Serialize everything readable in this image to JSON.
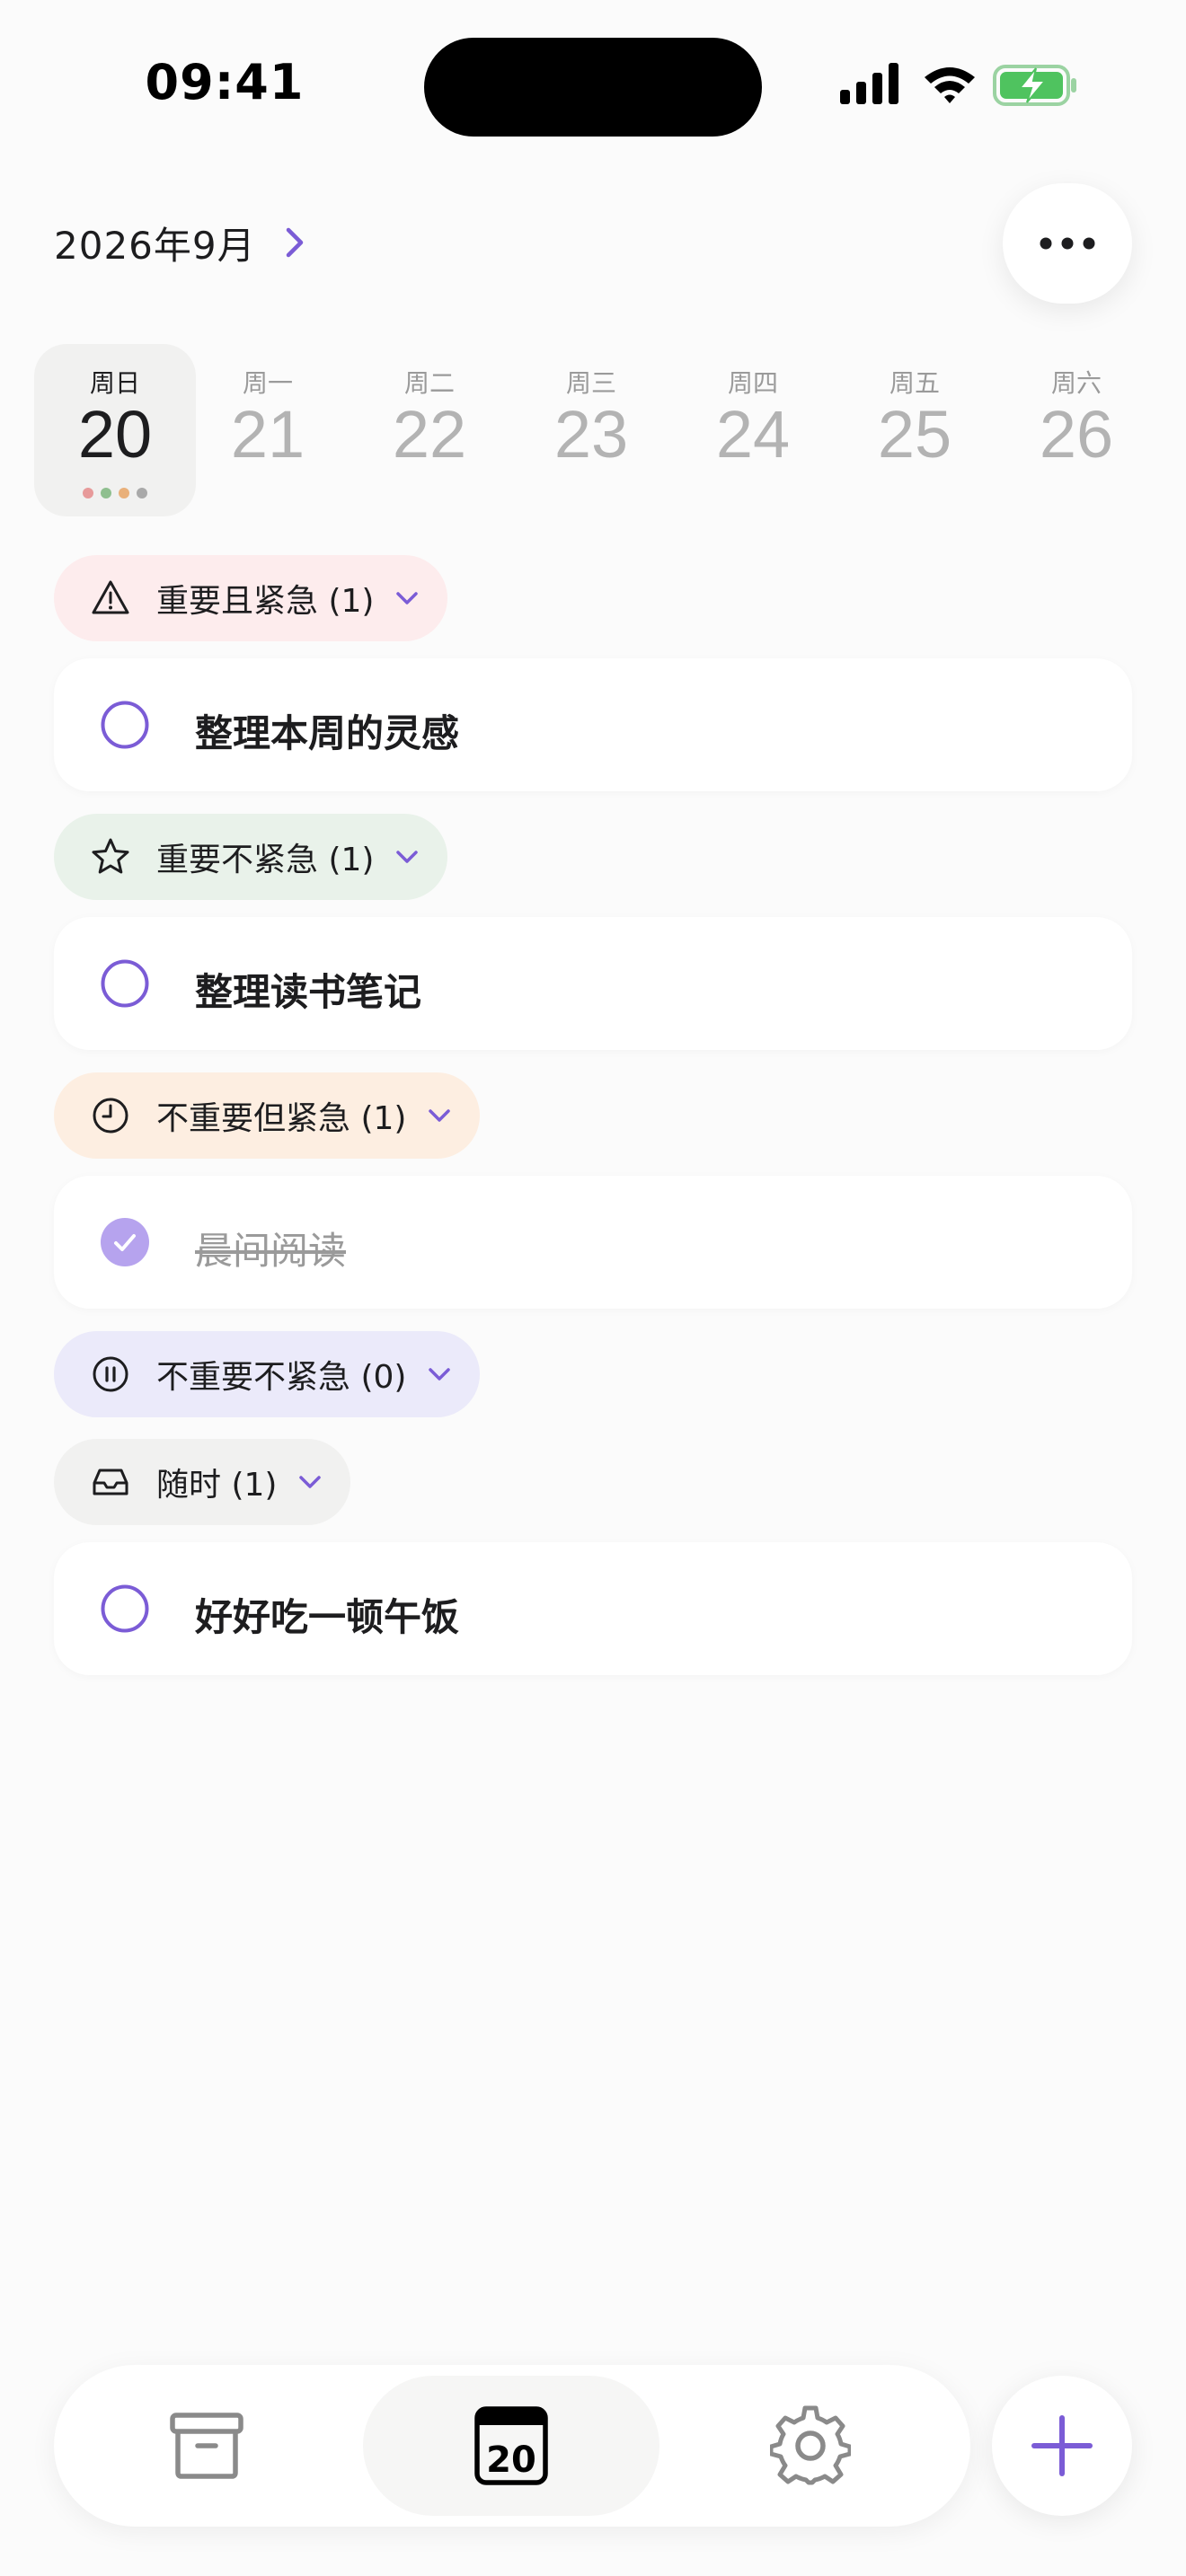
{
  "status_bar": {
    "time": "09:41"
  },
  "header": {
    "month": "2026年9月"
  },
  "week": [
    {
      "weekday": "周日",
      "date": "20",
      "selected": true
    },
    {
      "weekday": "周一",
      "date": "21",
      "selected": false
    },
    {
      "weekday": "周二",
      "date": "22",
      "selected": false
    },
    {
      "weekday": "周三",
      "date": "23",
      "selected": false
    },
    {
      "weekday": "周四",
      "date": "24",
      "selected": false
    },
    {
      "weekday": "周五",
      "date": "25",
      "selected": false
    },
    {
      "weekday": "周六",
      "date": "26",
      "selected": false
    }
  ],
  "day_dots": [
    "#e79a9a",
    "#8fbf8f",
    "#e9b07a",
    "#a9a9a9"
  ],
  "sections": [
    {
      "label": "重要且紧急 (1)",
      "icon": "warning-triangle-icon",
      "bg": "#fdeced",
      "tasks": [
        {
          "title": "整理本周的灵感",
          "done": false
        }
      ]
    },
    {
      "label": "重要不紧急 (1)",
      "icon": "star-icon",
      "bg": "#e9f2ea",
      "tasks": [
        {
          "title": "整理读书笔记",
          "done": false
        }
      ]
    },
    {
      "label": "不重要但紧急 (1)",
      "icon": "clock-icon",
      "bg": "#fdeee1",
      "tasks": [
        {
          "title": "晨间阅读",
          "done": true
        }
      ]
    },
    {
      "label": "不重要不紧急 (0)",
      "icon": "pause-circle-icon",
      "bg": "#ebeafa",
      "tasks": []
    },
    {
      "label": "随时 (1)",
      "icon": "inbox-tray-icon",
      "bg": "#f1f1f0",
      "tasks": [
        {
          "title": "好好吃一顿午饭",
          "done": false
        }
      ]
    }
  ],
  "tab_bar": {
    "tabs": [
      {
        "name": "archive",
        "icon": "archive-box-icon"
      },
      {
        "name": "calendar",
        "icon": "calendar-icon",
        "badge": "20",
        "active": true
      },
      {
        "name": "settings",
        "icon": "gear-icon"
      }
    ]
  },
  "colors": {
    "accent": "#7b5cd6",
    "accent_light": "#b6a3ee",
    "text_primary": "#1d1d1f",
    "text_muted": "#9a9a9a",
    "battery_green": "#4fc35f"
  }
}
